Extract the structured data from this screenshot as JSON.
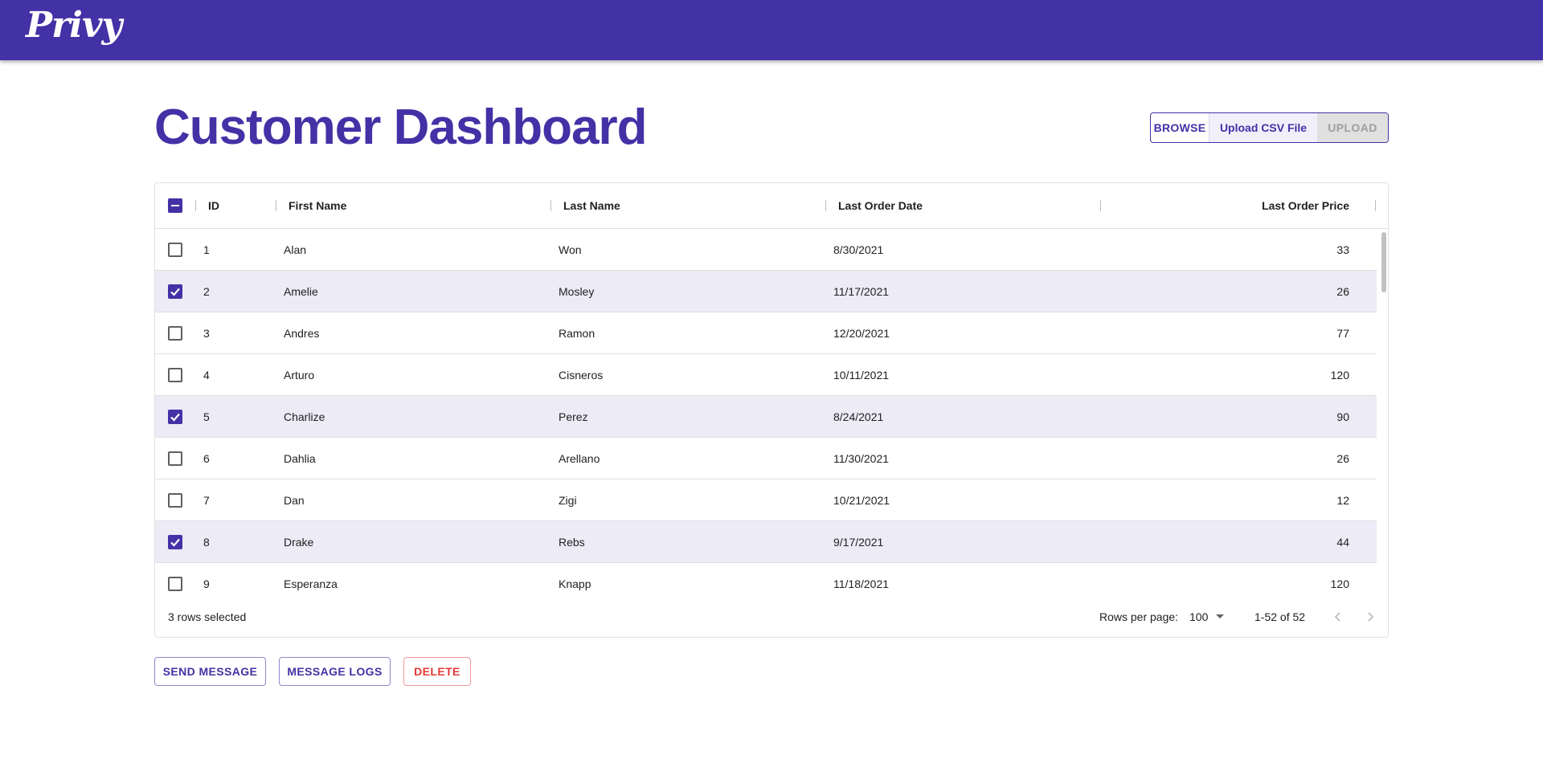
{
  "app": {
    "logo_text": "Privy"
  },
  "page": {
    "title": "Customer Dashboard"
  },
  "upload": {
    "browse_label": "BROWSE",
    "file_label": "Upload CSV File",
    "upload_label": "UPLOAD"
  },
  "table": {
    "columns": [
      "ID",
      "First Name",
      "Last Name",
      "Last Order Date",
      "Last Order Price"
    ],
    "rows": [
      {
        "id": "1",
        "first": "Alan",
        "last": "Won",
        "date": "8/30/2021",
        "price": "33",
        "selected": false
      },
      {
        "id": "2",
        "first": "Amelie",
        "last": "Mosley",
        "date": "11/17/2021",
        "price": "26",
        "selected": true
      },
      {
        "id": "3",
        "first": "Andres",
        "last": "Ramon",
        "date": "12/20/2021",
        "price": "77",
        "selected": false
      },
      {
        "id": "4",
        "first": "Arturo",
        "last": "Cisneros",
        "date": "10/11/2021",
        "price": "120",
        "selected": false
      },
      {
        "id": "5",
        "first": "Charlize",
        "last": "Perez",
        "date": "8/24/2021",
        "price": "90",
        "selected": true
      },
      {
        "id": "6",
        "first": "Dahlia",
        "last": "Arellano",
        "date": "11/30/2021",
        "price": "26",
        "selected": false
      },
      {
        "id": "7",
        "first": "Dan",
        "last": "Zigi",
        "date": "10/21/2021",
        "price": "12",
        "selected": false
      },
      {
        "id": "8",
        "first": "Drake",
        "last": "Rebs",
        "date": "9/17/2021",
        "price": "44",
        "selected": true
      },
      {
        "id": "9",
        "first": "Esperanza",
        "last": "Knapp",
        "date": "11/18/2021",
        "price": "120",
        "selected": false
      }
    ],
    "selected_text": "3 rows selected",
    "rows_per_page_label": "Rows per page:",
    "rows_per_page_value": "100",
    "range_text": "1-52 of 52"
  },
  "actions": {
    "send_message": "SEND MESSAGE",
    "message_logs": "MESSAGE LOGS",
    "delete": "DELETE"
  },
  "colors": {
    "brand": "#4331a6",
    "danger": "#e53935",
    "selected_row": "#ecebf6"
  },
  "icons": {
    "header_checkbox": "indeterminate-checkbox-icon",
    "prev": "chevron-left-icon",
    "next": "chevron-right-icon",
    "dropdown": "caret-down-icon"
  }
}
